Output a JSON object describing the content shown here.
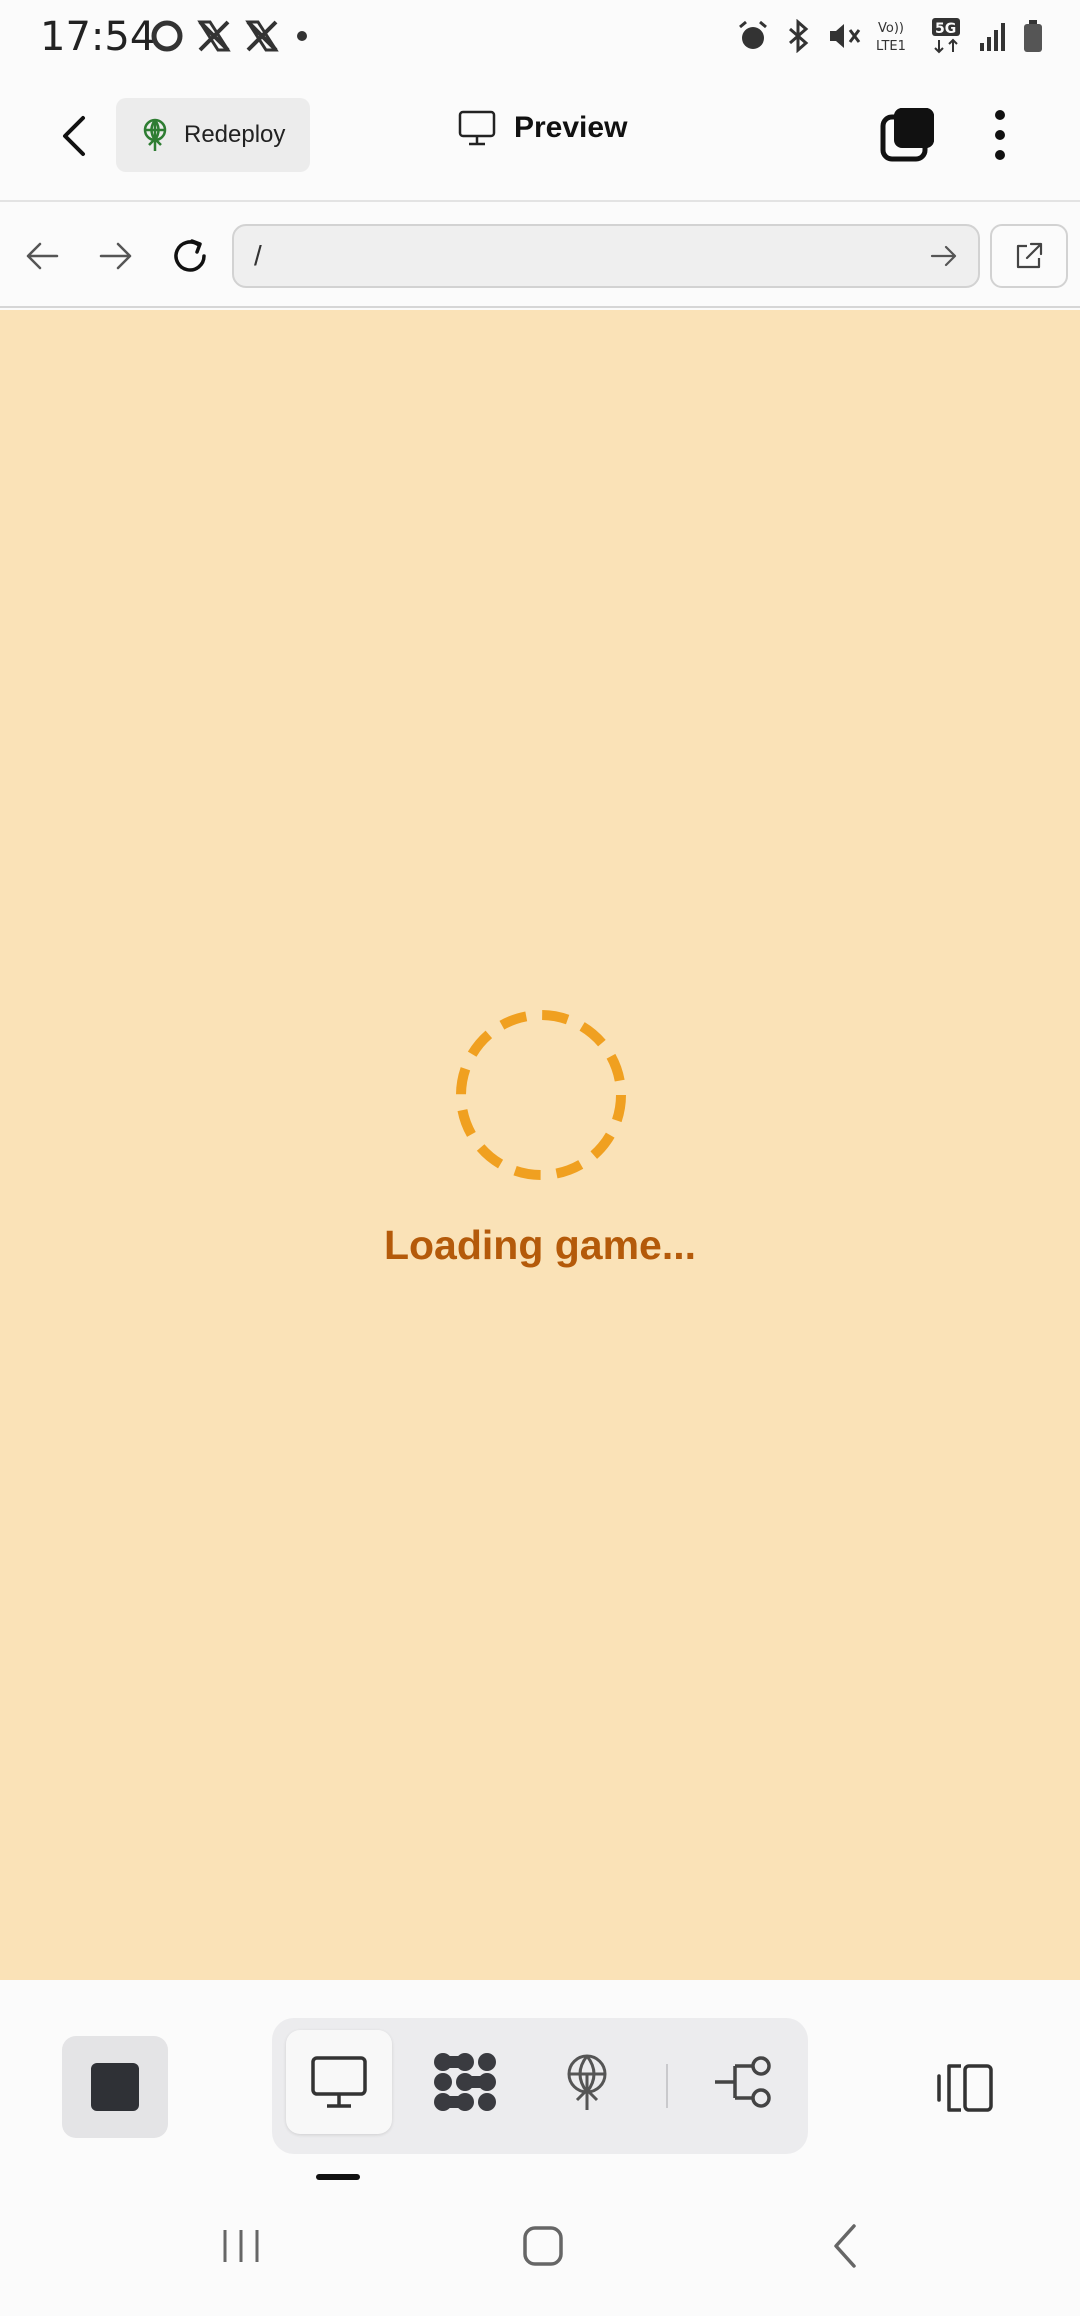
{
  "status_bar": {
    "time": "17:54",
    "left_icons": [
      "circle-app-icon",
      "x-logo-icon",
      "x-logo-icon",
      "dot-icon"
    ],
    "right_icons": [
      "alarm-icon",
      "bluetooth-icon",
      "mute-icon",
      "volte-icon",
      "5g-icon",
      "signal-icon",
      "battery-icon"
    ],
    "volte_label": "Vo)) LTE1",
    "network_label": "5G"
  },
  "header": {
    "redeploy_label": "Redeploy",
    "title": "Preview"
  },
  "browser": {
    "url": "/"
  },
  "content": {
    "loading_text": "Loading game...",
    "background_color": "#fae2b7",
    "spinner_color": "#f0a020",
    "text_color": "#b45a0a"
  },
  "toolbar": {
    "tools": [
      "preview-tool",
      "workspace-tool",
      "deploy-tool",
      "git-tool"
    ],
    "active_tool": "preview-tool"
  }
}
